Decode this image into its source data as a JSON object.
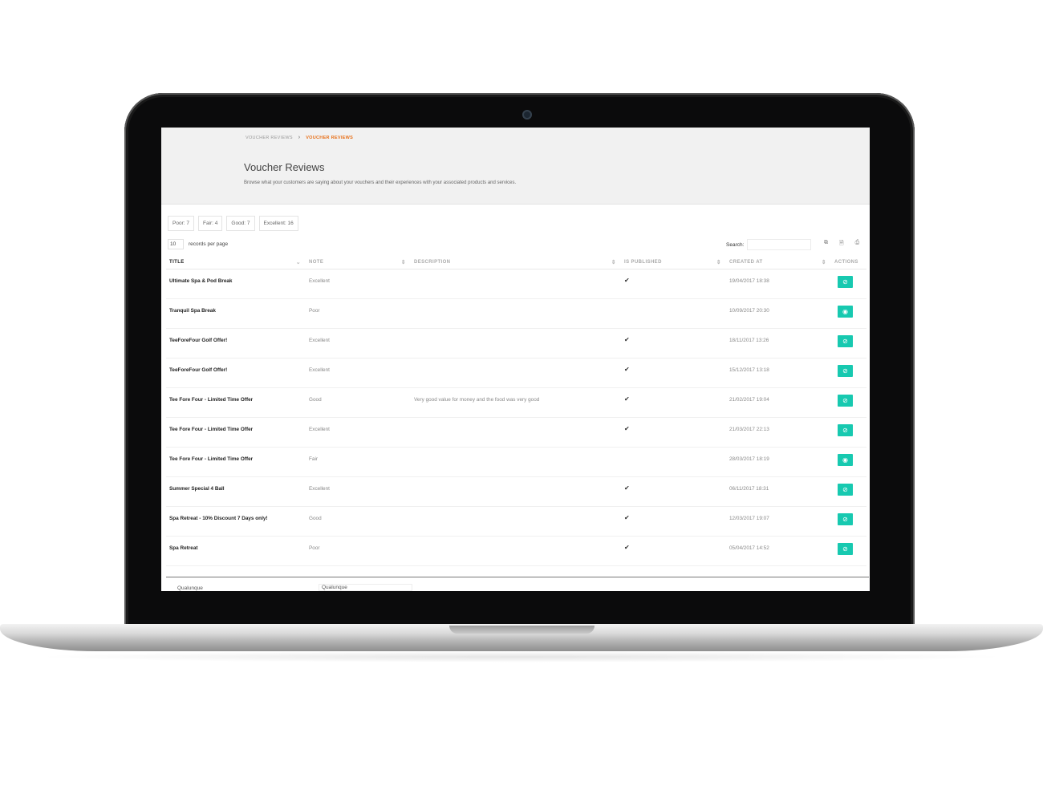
{
  "breadcrumb": {
    "parent": "VOUCHER REVIEWS",
    "separator": "›",
    "current": "VOUCHER REVIEWS"
  },
  "page": {
    "title": "Voucher Reviews",
    "subtitle": "Browse what your customers are saying about your vouchers and their experiences with your associated products and services."
  },
  "filters": [
    "Poor: 7",
    "Fair: 4",
    "Good: 7",
    "Excellent: 16"
  ],
  "records": {
    "value": "10",
    "label": "records per page"
  },
  "search": {
    "label": "Search:",
    "placeholder": ""
  },
  "toolbar": {
    "copy_icon": "⧉",
    "csv_icon": "🗎",
    "print_icon": "⎙"
  },
  "colors": {
    "accent": "#e8721c",
    "action": "#17c9b0"
  },
  "table": {
    "headers": [
      "TITLE",
      "NOTE",
      "DESCRIPTION",
      "IS PUBLISHED",
      "CREATED AT",
      "ACTIONS"
    ],
    "rows": [
      {
        "title": "Ultimate Spa & Pod Break",
        "note": "Excellent",
        "desc": "",
        "published": "✔",
        "created": "19/04/2017 18:38",
        "action": "⊘"
      },
      {
        "title": "Tranquil Spa Break",
        "note": "Poor",
        "desc": "",
        "published": "",
        "created": "10/09/2017 20:30",
        "action": "◉"
      },
      {
        "title": "TeeForeFour Golf Offer!",
        "note": "Excellent",
        "desc": "",
        "published": "✔",
        "created": "18/11/2017 13:26",
        "action": "⊘"
      },
      {
        "title": "TeeForeFour Golf Offer!",
        "note": "Excellent",
        "desc": "",
        "published": "✔",
        "created": "15/12/2017 13:18",
        "action": "⊘"
      },
      {
        "title": "Tee Fore Four - Limited Time Offer",
        "note": "Good",
        "desc": "Very good value for money and the food was very good",
        "published": "✔",
        "created": "21/02/2017 19:04",
        "action": "⊘"
      },
      {
        "title": "Tee Fore Four - Limited Time Offer",
        "note": "Excellent",
        "desc": "",
        "published": "✔",
        "created": "21/03/2017 22:13",
        "action": "⊘"
      },
      {
        "title": "Tee Fore Four - Limited Time Offer",
        "note": "Fair",
        "desc": "",
        "published": "",
        "created": "28/03/2017 18:19",
        "action": "◉"
      },
      {
        "title": "Summer Special 4 Ball",
        "note": "Excellent",
        "desc": "",
        "published": "✔",
        "created": "06/11/2017 18:31",
        "action": "⊘"
      },
      {
        "title": "Spa Retreat - 10% Discount 7 Days only!",
        "note": "Good",
        "desc": "",
        "published": "✔",
        "created": "12/03/2017 19:07",
        "action": "⊘"
      },
      {
        "title": "Spa Retreat",
        "note": "Poor",
        "desc": "",
        "published": "✔",
        "created": "05/04/2017 14:52",
        "action": "⊘"
      }
    ],
    "footer_filters": [
      "Qualunque",
      "Qualunque"
    ]
  }
}
